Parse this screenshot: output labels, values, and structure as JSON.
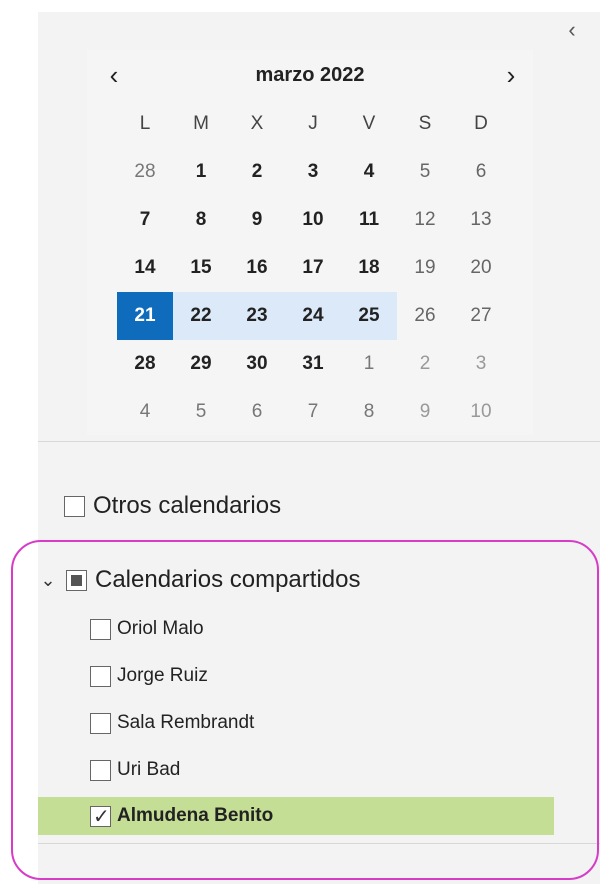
{
  "calendar": {
    "title": "marzo 2022",
    "prev_label": "‹",
    "next_label": "›",
    "weekdays": [
      "L",
      "M",
      "X",
      "J",
      "V",
      "S",
      "D"
    ],
    "weeks": [
      [
        "28",
        "1",
        "2",
        "3",
        "4",
        "5",
        "6"
      ],
      [
        "7",
        "8",
        "9",
        "10",
        "11",
        "12",
        "13"
      ],
      [
        "14",
        "15",
        "16",
        "17",
        "18",
        "19",
        "20"
      ],
      [
        "21",
        "22",
        "23",
        "24",
        "25",
        "26",
        "27"
      ],
      [
        "28",
        "29",
        "30",
        "31",
        "1",
        "2",
        "3"
      ],
      [
        "4",
        "5",
        "6",
        "7",
        "8",
        "9",
        "10"
      ]
    ],
    "today": "21"
  },
  "pane": {
    "collapse_label": "‹"
  },
  "groups": {
    "other": {
      "label": "Otros calendarios"
    },
    "shared": {
      "label": "Calendarios compartidos",
      "chevron": "⌄",
      "items": [
        {
          "label": "Oriol Malo",
          "checked": false
        },
        {
          "label": "Jorge Ruiz",
          "checked": false
        },
        {
          "label": "Sala Rembrandt",
          "checked": false
        },
        {
          "label": "Uri Bad",
          "checked": false
        },
        {
          "label": "Almudena Benito",
          "checked": true
        }
      ]
    }
  },
  "colors": {
    "today_bg": "#0f6cbd",
    "week_highlight": "#dbe9f8",
    "selected_item_bg": "#c5de96",
    "annotation_ring": "#d63cc8"
  }
}
